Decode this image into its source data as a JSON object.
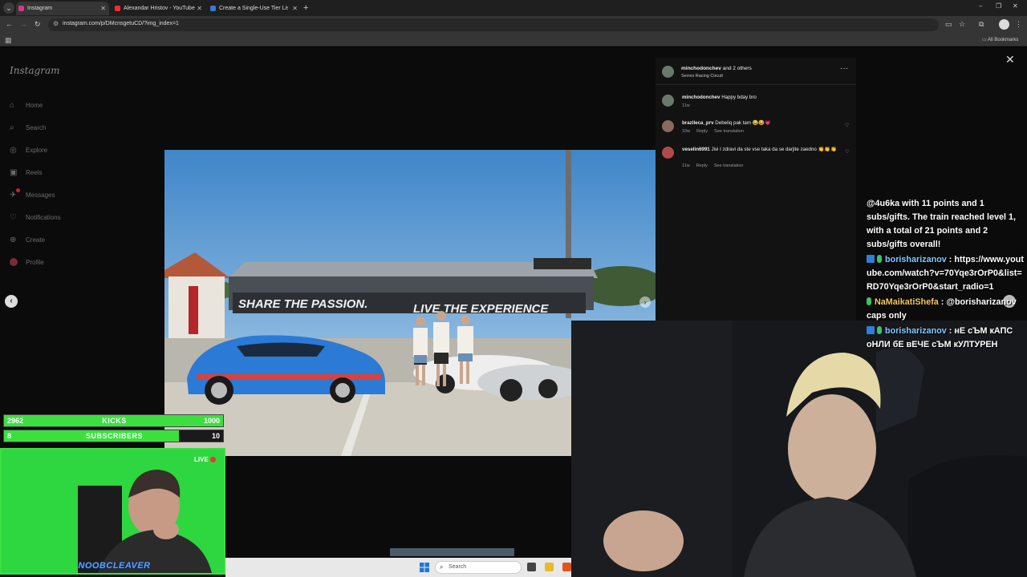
{
  "browser": {
    "tabs": [
      {
        "title": "Instagram",
        "active": true,
        "favicon_color": "#d3398a"
      },
      {
        "title": "Alexandar Hristov - YouTube",
        "active": false,
        "favicon_color": "#ff2b2b"
      },
      {
        "title": "Create a Single-Use Tier List (P…",
        "active": false,
        "favicon_color": "#3b78d8"
      }
    ],
    "new_tab": "+",
    "address": "instagram.com/p/DMcnsgetuCD/?img_index=1",
    "all_bookmarks": "All Bookmarks",
    "window_controls": [
      "–",
      "❐",
      "✕"
    ]
  },
  "instagram": {
    "logo": "Instagram",
    "nav": [
      {
        "label": "Home",
        "icon": "home-icon",
        "glyph": "⌂"
      },
      {
        "label": "Search",
        "icon": "search-icon",
        "glyph": "⌕"
      },
      {
        "label": "Explore",
        "icon": "explore-icon",
        "glyph": "◎"
      },
      {
        "label": "Reels",
        "icon": "reels-icon",
        "glyph": "▣"
      },
      {
        "label": "Messages",
        "icon": "messages-icon",
        "glyph": "✈"
      },
      {
        "label": "Notifications",
        "icon": "heart-icon",
        "glyph": "♡"
      },
      {
        "label": "Create",
        "icon": "create-icon",
        "glyph": "⊕"
      },
      {
        "label": "Profile",
        "icon": "profile-avatar",
        "glyph": ""
      }
    ],
    "post": {
      "user": "minchodonchev",
      "others": "and 2 others",
      "location": "Serres Racing Circuit",
      "more": "···",
      "banner_left": "SHARE THE PASSION.",
      "banner_right": "LIVE THE EXPERIENCE",
      "comments": [
        {
          "user": "minchodonchev",
          "text": "Happy bday bro",
          "time": "11w",
          "reply": "",
          "translate": "",
          "avatar_color": "#6a7a6a",
          "liked": false
        },
        {
          "user": "brazileca_prv",
          "text": "Debeliq pak tam 😂😂💗",
          "time": "10w",
          "reply": "Reply",
          "translate": "See translation",
          "avatar_color": "#8a6a5a",
          "liked": true
        },
        {
          "user": "veselin6991",
          "text": "Jivi I zdravi da ste vse taka da se darjite zaedno 👏👏👏",
          "time": "11w",
          "reply": "Reply",
          "translate": "See translation",
          "avatar_color": "#b04a4a",
          "liked": true
        }
      ]
    }
  },
  "stream": {
    "chat": [
      {
        "user": "",
        "text": "@4u6ka with 11 points and 1 subs/gifts. The train reached level 1, with a total of 21 points and 2 subs/gifts overall!",
        "style": "plain"
      },
      {
        "user": "borisharizanov",
        "text": "https://www.youtube.com/watch?v=70Yqe3rOrP0&list=RD70Yqe3rOrP0&start_radio=1",
        "style": "blue"
      },
      {
        "user": "NaMaikatiShefa",
        "text": "@borisharizanov caps only",
        "style": "gold"
      },
      {
        "user": "borisharizanov",
        "text": "нЕ сЪМ кАПС оНЛИ бЕ вЕЧЕ сЪМ кУЛТУРЕН",
        "style": "blue"
      }
    ],
    "goals": [
      {
        "current": "2962",
        "label": "KICKS",
        "max": "1000",
        "progress": 1.0
      },
      {
        "current": "8",
        "label": "SUBSCRIBERS",
        "max": "10",
        "progress": 0.8
      }
    ],
    "live_label": "LIVE",
    "cam_name": "NOOBCLEAVER"
  },
  "taskbar": {
    "search_placeholder": "Search"
  },
  "colors": {
    "accent_green": "#3be03f",
    "chat_blue": "#7ec9ff",
    "chat_gold": "#f6c75a"
  }
}
